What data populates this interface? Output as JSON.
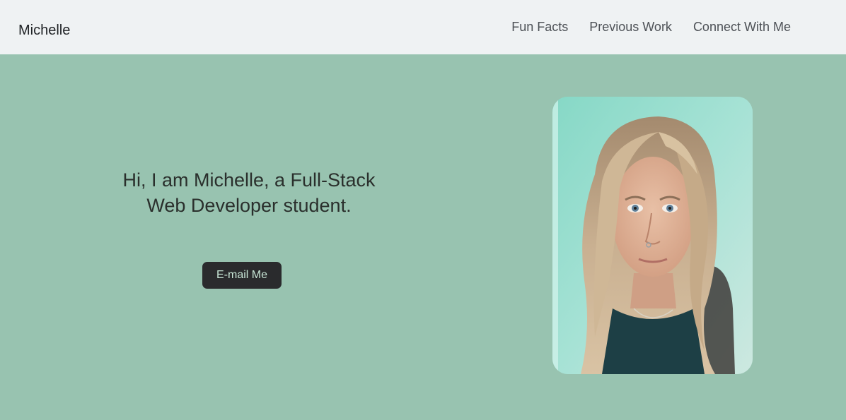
{
  "nav": {
    "brand": "Michelle",
    "links": [
      "Fun Facts",
      "Previous Work",
      "Connect With Me"
    ]
  },
  "hero": {
    "headline": "Hi, I am Michelle, a Full-Stack Web Developer student.",
    "button_label": "E-mail Me",
    "photo_alt": "Portrait of Michelle"
  },
  "colors": {
    "nav_bg": "#eff2f3",
    "hero_bg": "#98c3b0",
    "button_bg": "#2a2b2d",
    "button_text": "#c8e6d6"
  }
}
